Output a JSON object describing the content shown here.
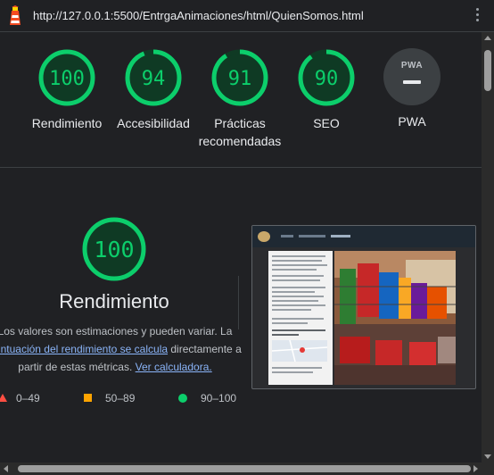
{
  "browser": {
    "url": "http://127.0.0.1:5500/EntrgaAnimaciones/html/QuienSomos.html",
    "logo_icon": "lighthouse-icon",
    "menu_icon": "kebab-menu-icon"
  },
  "summary": {
    "gauges": [
      {
        "score": "100",
        "label": "Rendimiento"
      },
      {
        "score": "94",
        "label": "Accesibilidad"
      },
      {
        "score": "91",
        "label": "Prácticas recomendadas"
      },
      {
        "score": "90",
        "label": "SEO"
      }
    ],
    "pwa": {
      "badge_text": "PWA",
      "label": "PWA"
    }
  },
  "performance": {
    "score": "100",
    "title": "Rendimiento",
    "desc_part1": "Los valores son estimaciones y pueden variar. La ",
    "desc_link1": "puntuación del rendimiento se calcula",
    "desc_part2": " directamente a partir de estas métricas. ",
    "desc_link2": "Ver calculadora."
  },
  "legend": {
    "fail": "0–49",
    "average": "50–89",
    "pass": "90–100"
  },
  "colors": {
    "pass": "#0cce6b",
    "average": "#ffa400",
    "fail": "#ff4e42",
    "background": "#202124",
    "link": "#8ab4f8"
  }
}
